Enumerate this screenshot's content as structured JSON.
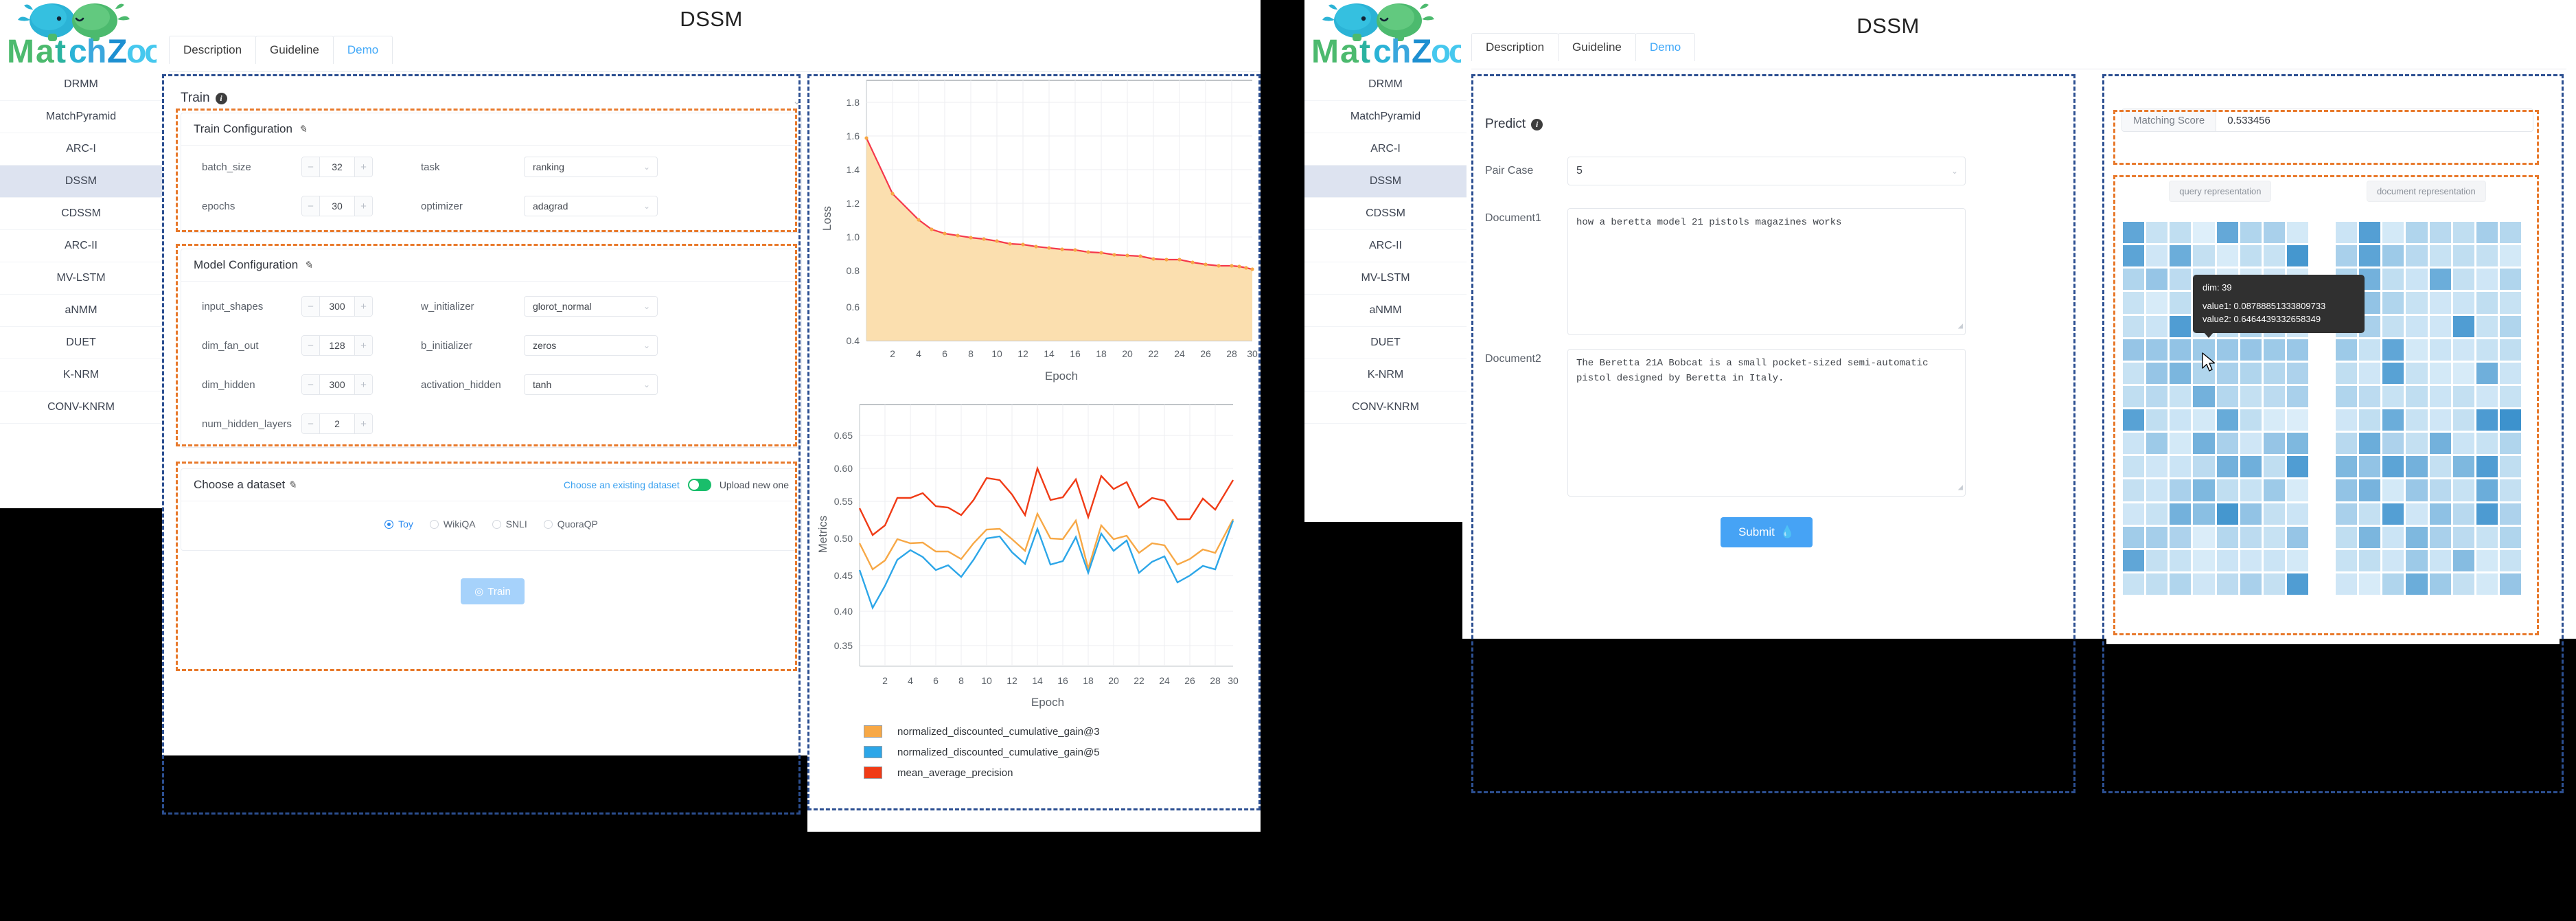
{
  "brand": {
    "name": "MatchZoo"
  },
  "windows": [
    {
      "id": "train-window",
      "title": "DSSM",
      "tabs": [
        {
          "label": "Description",
          "active": false
        },
        {
          "label": "Guideline",
          "active": false
        },
        {
          "label": "Demo",
          "active": true
        }
      ]
    },
    {
      "id": "predict-window",
      "title": "DSSM",
      "tabs": [
        {
          "label": "Description",
          "active": false
        },
        {
          "label": "Guideline",
          "active": false
        },
        {
          "label": "Demo",
          "active": true
        }
      ]
    }
  ],
  "sidebar": {
    "items": [
      {
        "label": "DRMM",
        "active": false
      },
      {
        "label": "MatchPyramid",
        "active": false
      },
      {
        "label": "ARC-I",
        "active": false
      },
      {
        "label": "DSSM",
        "active": true
      },
      {
        "label": "CDSSM",
        "active": false
      },
      {
        "label": "ARC-II",
        "active": false
      },
      {
        "label": "MV-LSTM",
        "active": false
      },
      {
        "label": "aNMM",
        "active": false
      },
      {
        "label": "DUET",
        "active": false
      },
      {
        "label": "K-NRM",
        "active": false
      },
      {
        "label": "CONV-KNRM",
        "active": false
      }
    ]
  },
  "train_panel": {
    "section_title": "Train",
    "info_icon": "info-icon",
    "collapse_icon": "chevron-up-icon",
    "train_config": {
      "title": "Train Configuration",
      "edit_icon": "pencil-icon",
      "fields": [
        {
          "label": "batch_size",
          "type": "stepper",
          "value": "32"
        },
        {
          "label": "task",
          "type": "select",
          "value": "ranking"
        },
        {
          "label": "epochs",
          "type": "stepper",
          "value": "30"
        },
        {
          "label": "optimizer",
          "type": "select",
          "value": "adagrad"
        }
      ]
    },
    "model_config": {
      "title": "Model Configuration",
      "edit_icon": "pencil-icon",
      "fields": [
        {
          "label": "input_shapes",
          "type": "stepper",
          "value": "300"
        },
        {
          "label": "w_initializer",
          "type": "select",
          "value": "glorot_normal"
        },
        {
          "label": "dim_fan_out",
          "type": "stepper",
          "value": "128"
        },
        {
          "label": "b_initializer",
          "type": "select",
          "value": "zeros"
        },
        {
          "label": "dim_hidden",
          "type": "stepper",
          "value": "300"
        },
        {
          "label": "activation_hidden",
          "type": "select",
          "value": "tanh"
        },
        {
          "label": "num_hidden_layers",
          "type": "stepper",
          "value": "2"
        }
      ]
    },
    "dataset": {
      "title": "Choose a dataset",
      "edit_icon": "pencil-icon",
      "left_link": "Choose an existing dataset",
      "toggle_state": "on",
      "right_link": "Upload new one",
      "options": [
        {
          "label": "Toy",
          "selected": true
        },
        {
          "label": "WikiQA",
          "selected": false
        },
        {
          "label": "SNLI",
          "selected": false
        },
        {
          "label": "QuoraQP",
          "selected": false
        }
      ]
    },
    "train_button": {
      "label": "Train",
      "icon": "play-circle-icon"
    }
  },
  "predict_panel": {
    "section_title": "Predict",
    "info_icon": "info-icon",
    "pair_case": {
      "label": "Pair Case",
      "value": "5",
      "icon": "chevron-down-icon"
    },
    "document1": {
      "label": "Document1",
      "value": "how a beretta model 21 pistols magazines works"
    },
    "document2": {
      "label": "Document2",
      "value": "The Beretta 21A Bobcat is a small pocket-sized semi-automatic pistol designed by Beretta in Italy."
    },
    "submit_button": {
      "label": "Submit",
      "icon": "flame-icon"
    }
  },
  "result_panel": {
    "matching_score": {
      "label": "Matching Score",
      "value": "0.533456"
    },
    "query_rep_label": "query representation",
    "document_rep_label": "document representation",
    "tooltip": {
      "dim": "dim: 39",
      "value1": "value1: 0.08788851333809733",
      "value2": "value2: 0.6464439332658349"
    },
    "cursor_icon": "mouse-pointer-icon"
  },
  "colors": {
    "accent_blue": "#41a8f8",
    "dash_blue": "#2c4f91",
    "dash_orange": "#e8792b",
    "toggle_green": "#19be6b",
    "loss_line": "#f5384b",
    "loss_fill": "#fbdfaf",
    "ndcg3": "#f7a846",
    "ndcg5": "#2ca6e8",
    "map": "#f03b16",
    "heat_low": "#eaf6fd",
    "heat_high": "#2a87c8"
  },
  "chart_data": [
    {
      "type": "area",
      "title": "",
      "xlabel": "Epoch",
      "ylabel": "Loss",
      "xlim": [
        1,
        30
      ],
      "ylim": [
        0.4,
        1.9
      ],
      "xticks": [
        2,
        4,
        6,
        8,
        10,
        12,
        14,
        16,
        18,
        20,
        22,
        24,
        26,
        28,
        30
      ],
      "yticks": [
        0.4,
        0.6,
        0.8,
        1.0,
        1.2,
        1.4,
        1.6,
        1.8
      ],
      "grid": true,
      "legend": "none",
      "x": [
        1,
        2,
        3,
        4,
        5,
        6,
        7,
        8,
        9,
        10,
        11,
        12,
        13,
        14,
        15,
        16,
        17,
        18,
        19,
        20,
        21,
        22,
        23,
        24,
        25,
        26,
        27,
        28,
        29,
        30
      ],
      "series": [
        {
          "name": "loss",
          "color": "#f5384b",
          "marker_color": "#f7a846",
          "values": [
            1.556,
            1.232,
            1.079,
            1.022,
            0.996,
            0.985,
            0.973,
            0.965,
            0.954,
            0.937,
            0.934,
            0.921,
            0.913,
            0.905,
            0.901,
            0.892,
            0.885,
            0.875,
            0.869,
            0.866,
            0.85,
            0.845,
            0.845,
            0.83,
            0.82,
            0.812,
            0.809,
            0.806,
            0.798,
            0.79,
            0.784
          ]
        }
      ]
    },
    {
      "type": "line",
      "title": "",
      "xlabel": "Epoch",
      "ylabel": "Metrics",
      "xlim": [
        1,
        30
      ],
      "ylim": [
        0.33,
        0.68
      ],
      "xticks": [
        2,
        4,
        6,
        8,
        10,
        12,
        14,
        16,
        18,
        20,
        22,
        24,
        26,
        28,
        30
      ],
      "yticks": [
        0.35,
        0.4,
        0.45,
        0.5,
        0.55,
        0.6,
        0.65
      ],
      "grid": true,
      "legend": "bottom",
      "x": [
        1,
        2,
        3,
        4,
        5,
        6,
        7,
        8,
        9,
        10,
        11,
        12,
        13,
        14,
        15,
        16,
        17,
        18,
        19,
        20,
        21,
        22,
        23,
        24,
        25,
        26,
        27,
        28,
        29,
        30
      ],
      "series": [
        {
          "name": "normalized_discounted_cumulative_gain@3",
          "color": "#f7a846",
          "values": [
            0.497,
            0.462,
            0.474,
            0.503,
            0.497,
            0.498,
            0.486,
            0.486,
            0.476,
            0.498,
            0.517,
            0.518,
            0.503,
            0.487,
            0.538,
            0.504,
            0.503,
            0.528,
            0.463,
            0.52,
            0.502,
            0.507,
            0.484,
            0.497,
            0.494,
            0.468,
            0.475,
            0.488,
            0.483,
            0.529
          ]
        },
        {
          "name": "normalized_discounted_cumulative_gain@5",
          "color": "#2ca6e8",
          "values": [
            0.461,
            0.411,
            0.441,
            0.476,
            0.489,
            0.48,
            0.463,
            0.469,
            0.454,
            0.476,
            0.505,
            0.507,
            0.486,
            0.471,
            0.518,
            0.474,
            0.478,
            0.508,
            0.459,
            0.511,
            0.488,
            0.501,
            0.461,
            0.475,
            0.482,
            0.448,
            0.457,
            0.47,
            0.466,
            0.516
          ]
        },
        {
          "name": "mean_average_precision",
          "color": "#f03b16",
          "values": [
            0.545,
            0.508,
            0.521,
            0.56,
            0.56,
            0.567,
            0.549,
            0.547,
            0.537,
            0.558,
            0.589,
            0.586,
            0.566,
            0.537,
            0.602,
            0.557,
            0.561,
            0.587,
            0.535,
            0.591,
            0.573,
            0.583,
            0.548,
            0.56,
            0.556,
            0.531,
            0.531,
            0.559,
            0.544,
            0.585
          ]
        }
      ],
      "legend_entries": [
        {
          "label": "normalized_discounted_cumulative_gain@3",
          "color": "#f7a846"
        },
        {
          "label": "normalized_discounted_cumulative_gain@5",
          "color": "#2ca6e8"
        },
        {
          "label": "mean_average_precision",
          "color": "#f03b16"
        }
      ]
    },
    {
      "type": "heatmap",
      "title": "query representation",
      "rows": 16,
      "cols": 8,
      "colorscale": [
        "#eaf6fd",
        "#2a87c8"
      ],
      "values": [
        [
          0.72,
          0.18,
          0.22,
          0.06,
          0.7,
          0.3,
          0.34,
          0.12
        ],
        [
          0.74,
          0.14,
          0.66,
          0.2,
          0.1,
          0.22,
          0.18,
          0.86
        ],
        [
          0.3,
          0.44,
          0.24,
          0.16,
          0.1,
          0.12,
          0.14,
          0.12
        ],
        [
          0.18,
          0.1,
          0.22,
          0.14,
          0.1,
          0.16,
          0.18,
          0.1
        ],
        [
          0.2,
          0.16,
          0.8,
          0.1,
          0.22,
          0.3,
          0.24,
          0.14
        ],
        [
          0.44,
          0.42,
          0.46,
          0.4,
          0.42,
          0.44,
          0.4,
          0.42
        ],
        [
          0.18,
          0.44,
          0.58,
          0.3,
          0.34,
          0.3,
          0.28,
          0.32
        ],
        [
          0.22,
          0.26,
          0.18,
          0.62,
          0.28,
          0.2,
          0.24,
          0.34
        ],
        [
          0.76,
          0.22,
          0.16,
          0.12,
          0.68,
          0.22,
          0.1,
          0.08
        ],
        [
          0.16,
          0.4,
          0.12,
          0.62,
          0.34,
          0.14,
          0.44,
          0.56
        ],
        [
          0.18,
          0.14,
          0.16,
          0.24,
          0.62,
          0.64,
          0.22,
          0.8
        ],
        [
          0.2,
          0.16,
          0.34,
          0.56,
          0.22,
          0.18,
          0.4,
          0.1
        ],
        [
          0.14,
          0.18,
          0.62,
          0.5,
          0.86,
          0.46,
          0.2,
          0.16
        ],
        [
          0.38,
          0.36,
          0.32,
          0.08,
          0.28,
          0.24,
          0.18,
          0.44
        ],
        [
          0.72,
          0.2,
          0.18,
          0.1,
          0.16,
          0.14,
          0.16,
          0.12
        ],
        [
          0.18,
          0.22,
          0.3,
          0.14,
          0.24,
          0.34,
          0.2,
          0.8
        ]
      ]
    },
    {
      "type": "heatmap",
      "title": "document representation",
      "rows": 16,
      "cols": 8,
      "colorscale": [
        "#eaf6fd",
        "#2a87c8"
      ],
      "values": [
        [
          0.16,
          0.78,
          0.12,
          0.3,
          0.26,
          0.22,
          0.36,
          0.28
        ],
        [
          0.34,
          0.74,
          0.4,
          0.26,
          0.18,
          0.22,
          0.2,
          0.12
        ],
        [
          0.3,
          0.62,
          0.22,
          0.16,
          0.66,
          0.2,
          0.14,
          0.3
        ],
        [
          0.24,
          0.46,
          0.3,
          0.18,
          0.14,
          0.16,
          0.22,
          0.18
        ],
        [
          0.22,
          0.34,
          0.2,
          0.16,
          0.14,
          0.8,
          0.18,
          0.3
        ],
        [
          0.4,
          0.18,
          0.72,
          0.12,
          0.16,
          0.14,
          0.18,
          0.22
        ],
        [
          0.22,
          0.14,
          0.76,
          0.18,
          0.12,
          0.1,
          0.64,
          0.16
        ],
        [
          0.3,
          0.24,
          0.18,
          0.22,
          0.16,
          0.2,
          0.14,
          0.18
        ],
        [
          0.14,
          0.22,
          0.66,
          0.18,
          0.14,
          0.2,
          0.82,
          0.9
        ],
        [
          0.26,
          0.66,
          0.32,
          0.2,
          0.62,
          0.16,
          0.18,
          0.3
        ],
        [
          0.56,
          0.46,
          0.74,
          0.62,
          0.2,
          0.56,
          0.8,
          0.22
        ],
        [
          0.46,
          0.6,
          0.12,
          0.42,
          0.26,
          0.18,
          0.66,
          0.2
        ],
        [
          0.34,
          0.2,
          0.78,
          0.14,
          0.48,
          0.26,
          0.82,
          0.32
        ],
        [
          0.22,
          0.58,
          0.16,
          0.56,
          0.34,
          0.24,
          0.18,
          0.3
        ],
        [
          0.18,
          0.22,
          0.14,
          0.4,
          0.16,
          0.52,
          0.12,
          0.18
        ],
        [
          0.14,
          0.1,
          0.3,
          0.66,
          0.4,
          0.2,
          0.12,
          0.44
        ]
      ]
    }
  ]
}
